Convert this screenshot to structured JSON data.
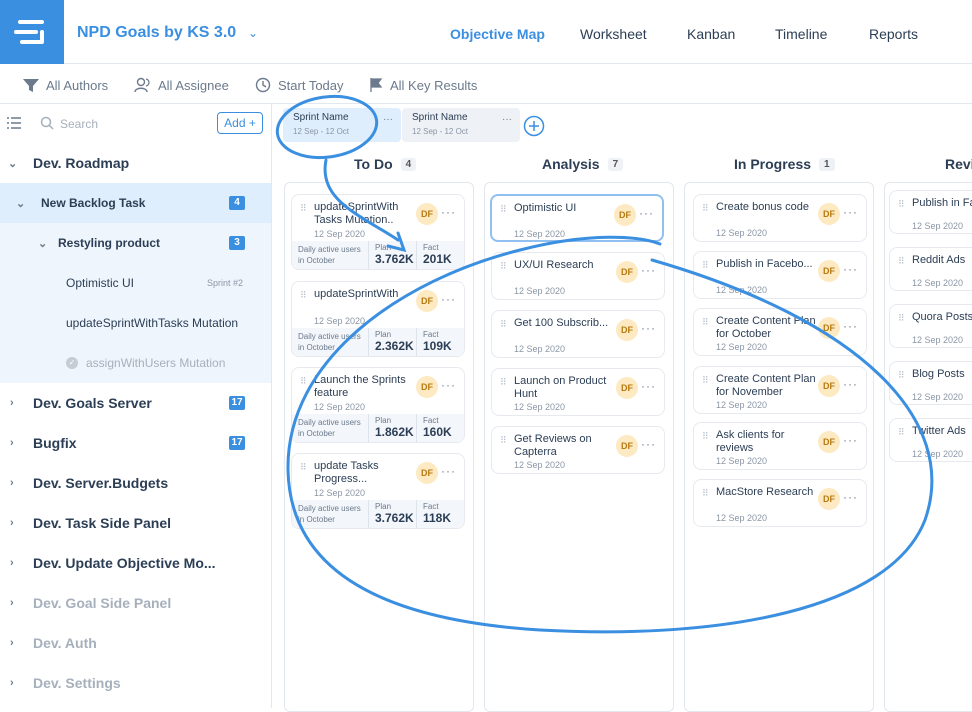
{
  "app": {
    "title": "NPD Goals by KS 3.0"
  },
  "nav": [
    "Objective Map",
    "Worksheet",
    "Kanban",
    "Timeline",
    "Reports"
  ],
  "filters": [
    "All Authors",
    "All Assignee",
    "Start Today",
    "All Key Results"
  ],
  "sidebar": {
    "search_placeholder": "Search",
    "add_label": "Add +",
    "items": [
      {
        "label": "Dev. Roadmap"
      },
      {
        "label": "New Backlog Task",
        "badge": "4"
      },
      {
        "label": "Restyling product",
        "badge": "3"
      },
      {
        "label": "Optimistic UI",
        "tag": "Sprint #2"
      },
      {
        "label": "updateSprintWithTasks Mutation"
      },
      {
        "label": "assignWithUsers Mutation"
      },
      {
        "label": "Dev. Goals Server",
        "badge": "17"
      },
      {
        "label": "Bugfix",
        "badge": "17"
      },
      {
        "label": "Dev. Server.Budgets"
      },
      {
        "label": "Dev. Task Side Panel"
      },
      {
        "label": "Dev. Update Objective Mo..."
      },
      {
        "label": "Dev. Goal Side Panel"
      },
      {
        "label": "Dev. Auth"
      },
      {
        "label": "Dev. Settings"
      }
    ]
  },
  "sprints": [
    {
      "name": "Sprint Name",
      "dates": "12 Sep - 12 Oct"
    },
    {
      "name": "Sprint Name",
      "dates": "12 Sep - 12 Oct"
    }
  ],
  "columns": [
    {
      "title": "To Do",
      "count": "4",
      "cards": [
        {
          "title": "updateSprintWith Tasks Mutation..",
          "date": "12 Sep 2020",
          "metric": "Daily active users in October",
          "plan_label": "Plan",
          "plan": "3.762K",
          "fact_label": "Fact",
          "fact": "201K"
        },
        {
          "title": "updateSprintWith",
          "date": "12 Sep 2020",
          "metric": "Daily active users in October",
          "plan_label": "Plan",
          "plan": "2.362K",
          "fact_label": "Fact",
          "fact": "109K"
        },
        {
          "title": "Launch the Sprints feature",
          "date": "12 Sep 2020",
          "metric": "Daily active users in October",
          "plan_label": "Plan",
          "plan": "1.862K",
          "fact_label": "Fact",
          "fact": "160K"
        },
        {
          "title": "update Tasks Progress...",
          "date": "12 Sep 2020",
          "metric": "Daily active users in October",
          "plan_label": "Plan",
          "plan": "3.762K",
          "fact_label": "Fact",
          "fact": "118K"
        }
      ]
    },
    {
      "title": "Analysis",
      "count": "7",
      "cards": [
        {
          "title": "Optimistic UI",
          "date": "12 Sep 2020"
        },
        {
          "title": "UX/UI Research",
          "date": "12 Sep 2020"
        },
        {
          "title": "Get 100 Subscrib...",
          "date": "12 Sep 2020"
        },
        {
          "title": "Launch on Product Hunt",
          "date": "12 Sep 2020"
        },
        {
          "title": "Get Reviews on Capterra",
          "date": "12 Sep 2020"
        }
      ]
    },
    {
      "title": "In Progress",
      "count": "1",
      "cards": [
        {
          "title": "Create bonus code",
          "date": "12 Sep 2020"
        },
        {
          "title": "Publish in Facebo...",
          "date": "12 Sep 2020"
        },
        {
          "title": "Create Content Plan for October",
          "date": "12 Sep 2020"
        },
        {
          "title": "Create Content Plan for November",
          "date": "12 Sep 2020"
        },
        {
          "title": "Ask clients for reviews",
          "date": "12 Sep 2020"
        },
        {
          "title": "MacStore Research",
          "date": "12 Sep 2020"
        }
      ]
    },
    {
      "title": "Revi",
      "cards": [
        {
          "title": "Publish in Fa",
          "date": "12 Sep 2020"
        },
        {
          "title": "Reddit Ads",
          "date": "12 Sep 2020"
        },
        {
          "title": "Quora Posts",
          "date": "12 Sep 2020"
        },
        {
          "title": "Blog Posts",
          "date": "12 Sep 2020"
        },
        {
          "title": "Twitter Ads",
          "date": "12 Sep 2020"
        }
      ]
    }
  ],
  "avatar_initials": "DF",
  "colors": {
    "accent": "#3b8fe0",
    "avatar_bg": "#fde9c2"
  }
}
